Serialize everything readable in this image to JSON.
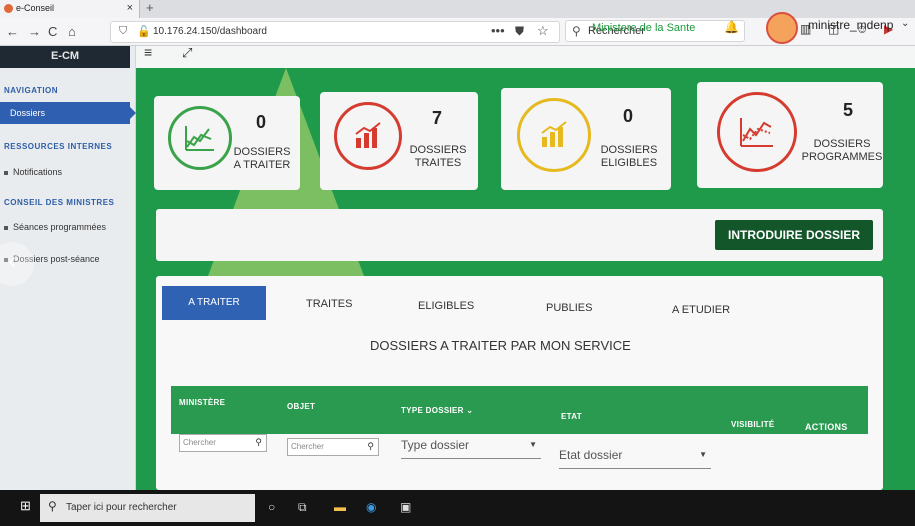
{
  "browser": {
    "tab_title": "e-Conseil",
    "tab_close": "×",
    "new_tab": "+",
    "nav_back": "←",
    "nav_forward": "→",
    "nav_reload": "C",
    "nav_home": "⌂",
    "url": "10.176.24.150/dashboard",
    "page_menu": "•••",
    "search_placeholder": "Rechercher"
  },
  "header": {
    "ministry": "Ministere de la Sante",
    "username": "ministre_mdenp",
    "brand": "E-CM"
  },
  "sidebar": {
    "nav_heading": "NAVIGATION",
    "dossiers": "Dossiers",
    "resources_heading": "RESSOURCES INTERNES",
    "notifications": "Notifications",
    "council_heading": "CONSEIL DES MINISTRES",
    "seances": "Séances programmées",
    "post_seance": "Dossiers post-séance"
  },
  "stats": [
    {
      "count": "0",
      "label1": "DOSSIERS",
      "label2": "A TRAITER",
      "color": "#3aa34a"
    },
    {
      "count": "7",
      "label1": "DOSSIERS",
      "label2": "TRAITES",
      "color": "#d63b2f"
    },
    {
      "count": "0",
      "label1": "DOSSIERS",
      "label2": "ELIGIBLES",
      "color": "#e6b91e"
    },
    {
      "count": "5",
      "label1": "DOSSIERS",
      "label2": "PROGRAMMES",
      "color": "#d63b2f"
    }
  ],
  "actions": {
    "introduce": "INTRODUIRE DOSSIER"
  },
  "tabs": [
    "A TRAITER",
    "TRAITES",
    "ELIGIBLES",
    "PUBLIES",
    "A ETUDIER"
  ],
  "panel_title": "DOSSIERS A TRAITER PAR MON SERVICE",
  "table": {
    "columns": [
      "MINISTÈRE",
      "OBJET",
      "TYPE DOSSIER",
      "ETAT",
      "VISIBILITÉ",
      "ACTIONS"
    ],
    "filter_placeholder_1": "Chercher",
    "filter_placeholder_2": "Chercher",
    "type_select": "Type dossier",
    "state_select": "Etat dossier"
  },
  "taskbar": {
    "search": "Taper ici pour rechercher"
  }
}
